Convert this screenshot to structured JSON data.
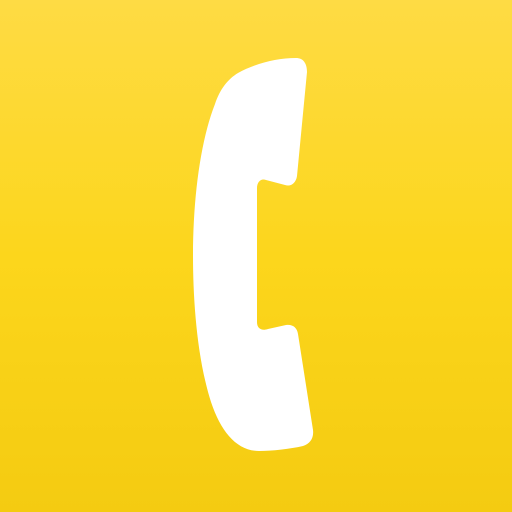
{
  "app_icon": {
    "icon": "phone-handset-icon",
    "colors": {
      "background_top": "#FEDB44",
      "background_mid": "#FCD61C",
      "background_bottom": "#F4CB11",
      "glyph": "#FFFFFF"
    }
  }
}
